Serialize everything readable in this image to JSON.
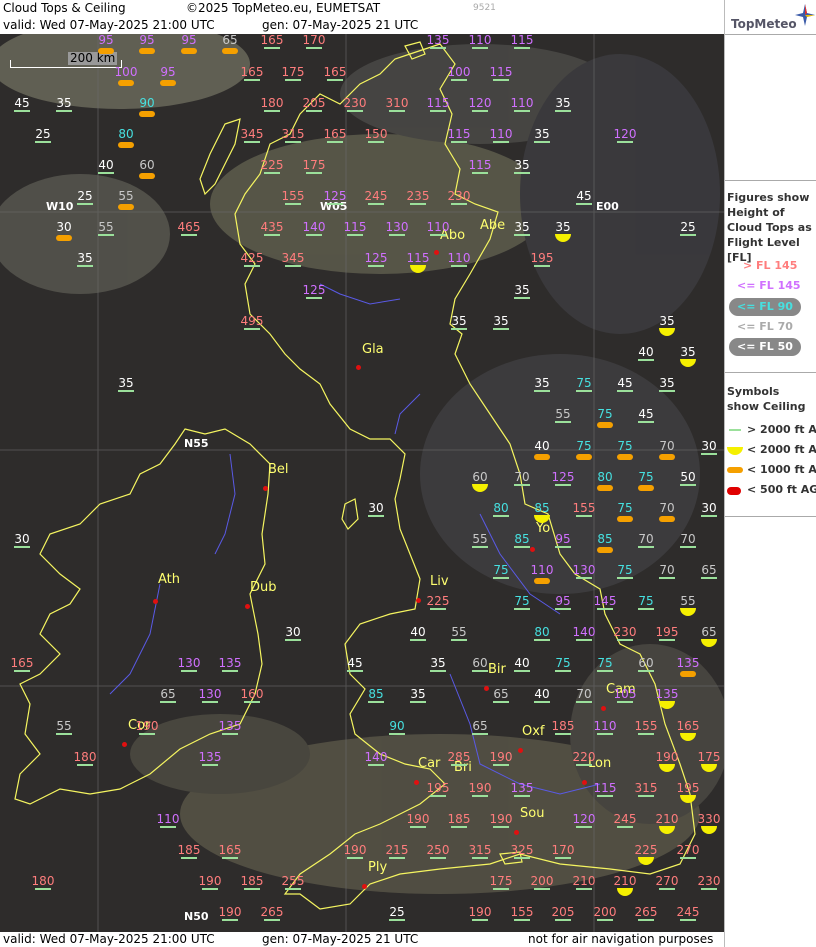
{
  "header": {
    "title": "Cloud Tops & Ceiling",
    "copyright": "©2025 TopMeteo.eu, EUMETSAT",
    "id_code": "9521",
    "valid_text": "valid:  Wed  07-May-2025  21:00 UTC",
    "gen_text": "gen: 07-May-2025 21 UTC"
  },
  "footer": {
    "valid_text": "valid:  Wed  07-May-2025  21:00 UTC",
    "gen_text": "gen: 07-May-2025 21 UTC",
    "disclaimer": "not for air navigation purposes"
  },
  "logo": {
    "text": "TopMeteo"
  },
  "scale_bar": {
    "label": "200 km"
  },
  "grid_labels": [
    "W10",
    "W05",
    "E00",
    "N55",
    "N50"
  ],
  "cities": [
    "Abo",
    "Abe",
    "Gla",
    "Bel",
    "Ath",
    "Dub",
    "Liv",
    "Yo",
    "Bir",
    "Cam",
    "Cor",
    "Oxf",
    "Car",
    "Bri",
    "Lon",
    "Sou",
    "Ply"
  ],
  "colors": {
    "above_145": "#ff7d7d",
    "le_145": "#d070ff",
    "le_90": "#46e0e0",
    "le_70": "#c8c8c8",
    "le_50": "#ffffff",
    "coast": "#f5f560",
    "river": "#5a5ae6",
    "sea": "#2e2c2b",
    "ceiling_2000": "#f5f000",
    "ceiling_1000": "#f5a000",
    "ceiling_500": "#e00000"
  },
  "legend": {
    "figures_title": "Figures show Height of Cloud Tops as Flight Level  [FL]",
    "fl_items": [
      "> FL 145",
      "<= FL 145",
      "<= FL 90",
      "<= FL 70",
      "<= FL 50"
    ],
    "symbols_title": "Symbols show Ceiling",
    "symbol_items": [
      "> 2000 ft AGL",
      "< 2000 ft AGL",
      "< 1000 ft AGL",
      "< 500 ft AGL"
    ]
  },
  "cloud_tops": [
    {
      "v": "95",
      "s": "p"
    },
    {
      "v": "95",
      "s": "p"
    },
    {
      "v": "95",
      "s": "p"
    },
    {
      "v": "65",
      "s": "p"
    },
    {
      "v": "165"
    },
    {
      "v": "170"
    },
    {
      "v": "135"
    },
    {
      "v": "110"
    },
    {
      "v": "115"
    },
    {
      "v": "100",
      "s": "p"
    },
    {
      "v": "95",
      "s": "p"
    },
    {
      "v": "165"
    },
    {
      "v": "175"
    },
    {
      "v": "165"
    },
    {
      "v": "100"
    },
    {
      "v": "115"
    },
    {
      "v": "45"
    },
    {
      "v": "35"
    },
    {
      "v": "90",
      "s": "p"
    },
    {
      "v": "180"
    },
    {
      "v": "205"
    },
    {
      "v": "230"
    },
    {
      "v": "310"
    },
    {
      "v": "115"
    },
    {
      "v": "120"
    },
    {
      "v": "110"
    },
    {
      "v": "35"
    },
    {
      "v": "25"
    },
    {
      "v": "80",
      "s": "p"
    },
    {
      "v": "345"
    },
    {
      "v": "315"
    },
    {
      "v": "165"
    },
    {
      "v": "150"
    },
    {
      "v": "115"
    },
    {
      "v": "110"
    },
    {
      "v": "35"
    },
    {
      "v": "120"
    },
    {
      "v": "40"
    },
    {
      "v": "60",
      "s": "p"
    },
    {
      "v": "225"
    },
    {
      "v": "175"
    },
    {
      "v": "115"
    },
    {
      "v": "35"
    },
    {
      "v": "25"
    },
    {
      "v": "55",
      "s": "p"
    },
    {
      "v": "155"
    },
    {
      "v": "125"
    },
    {
      "v": "245"
    },
    {
      "v": "235"
    },
    {
      "v": "230"
    },
    {
      "v": "45"
    },
    {
      "v": "30",
      "s": "p"
    },
    {
      "v": "55"
    },
    {
      "v": "465"
    },
    {
      "v": "435"
    },
    {
      "v": "140"
    },
    {
      "v": "115"
    },
    {
      "v": "130"
    },
    {
      "v": "110"
    },
    {
      "v": "35"
    },
    {
      "v": "35",
      "s": "c"
    },
    {
      "v": "25"
    },
    {
      "v": "35"
    },
    {
      "v": "425"
    },
    {
      "v": "345"
    },
    {
      "v": "125"
    },
    {
      "v": "115",
      "s": "c"
    },
    {
      "v": "110"
    },
    {
      "v": "195"
    },
    {
      "v": "125"
    },
    {
      "v": "35"
    },
    {
      "v": "495"
    },
    {
      "v": "35"
    },
    {
      "v": "35"
    },
    {
      "v": "35",
      "s": "c"
    },
    {
      "v": "40"
    },
    {
      "v": "35",
      "s": "c"
    },
    {
      "v": "35"
    },
    {
      "v": "35"
    },
    {
      "v": "75"
    },
    {
      "v": "45"
    },
    {
      "v": "35"
    },
    {
      "v": "55"
    },
    {
      "v": "75",
      "s": "p"
    },
    {
      "v": "45"
    },
    {
      "v": "40",
      "s": "p"
    },
    {
      "v": "75",
      "s": "p"
    },
    {
      "v": "75",
      "s": "p"
    },
    {
      "v": "70",
      "s": "p"
    },
    {
      "v": "30"
    },
    {
      "v": "60",
      "s": "c"
    },
    {
      "v": "70"
    },
    {
      "v": "125"
    },
    {
      "v": "80",
      "s": "p"
    },
    {
      "v": "75",
      "s": "p"
    },
    {
      "v": "50"
    },
    {
      "v": "30"
    },
    {
      "v": "80"
    },
    {
      "v": "85",
      "s": "c"
    },
    {
      "v": "155"
    },
    {
      "v": "75",
      "s": "p"
    },
    {
      "v": "70",
      "s": "p"
    },
    {
      "v": "30"
    },
    {
      "v": "30"
    },
    {
      "v": "55"
    },
    {
      "v": "85"
    },
    {
      "v": "95"
    },
    {
      "v": "85",
      "s": "p"
    },
    {
      "v": "70"
    },
    {
      "v": "70"
    },
    {
      "v": "75"
    },
    {
      "v": "110",
      "s": "p"
    },
    {
      "v": "130"
    },
    {
      "v": "75"
    },
    {
      "v": "70"
    },
    {
      "v": "65"
    },
    {
      "v": "75"
    },
    {
      "v": "95"
    },
    {
      "v": "145"
    },
    {
      "v": "75"
    },
    {
      "v": "55",
      "s": "c"
    },
    {
      "v": "225"
    },
    {
      "v": "30"
    },
    {
      "v": "40"
    },
    {
      "v": "55"
    },
    {
      "v": "80"
    },
    {
      "v": "140"
    },
    {
      "v": "230"
    },
    {
      "v": "195"
    },
    {
      "v": "65",
      "s": "c"
    },
    {
      "v": "165"
    },
    {
      "v": "130"
    },
    {
      "v": "135"
    },
    {
      "v": "45"
    },
    {
      "v": "35"
    },
    {
      "v": "60"
    },
    {
      "v": "40"
    },
    {
      "v": "75"
    },
    {
      "v": "75"
    },
    {
      "v": "60"
    },
    {
      "v": "135",
      "s": "p"
    },
    {
      "v": "65"
    },
    {
      "v": "130"
    },
    {
      "v": "160"
    },
    {
      "v": "85"
    },
    {
      "v": "35"
    },
    {
      "v": "65"
    },
    {
      "v": "40"
    },
    {
      "v": "70"
    },
    {
      "v": "105"
    },
    {
      "v": "135",
      "s": "c"
    },
    {
      "v": "55"
    },
    {
      "v": "190"
    },
    {
      "v": "135"
    },
    {
      "v": "90"
    },
    {
      "v": "65"
    },
    {
      "v": "185"
    },
    {
      "v": "110"
    },
    {
      "v": "155"
    },
    {
      "v": "165",
      "s": "c"
    },
    {
      "v": "180"
    },
    {
      "v": "135"
    },
    {
      "v": "140"
    },
    {
      "v": "285"
    },
    {
      "v": "190"
    },
    {
      "v": "220"
    },
    {
      "v": "190",
      "s": "c"
    },
    {
      "v": "175",
      "s": "c"
    },
    {
      "v": "195"
    },
    {
      "v": "190"
    },
    {
      "v": "135"
    },
    {
      "v": "115"
    },
    {
      "v": "315"
    },
    {
      "v": "195",
      "s": "c"
    },
    {
      "v": "110"
    },
    {
      "v": "190"
    },
    {
      "v": "185"
    },
    {
      "v": "190"
    },
    {
      "v": "120"
    },
    {
      "v": "245"
    },
    {
      "v": "210",
      "s": "c"
    },
    {
      "v": "330",
      "s": "c"
    },
    {
      "v": "185"
    },
    {
      "v": "165"
    },
    {
      "v": "190"
    },
    {
      "v": "215"
    },
    {
      "v": "250"
    },
    {
      "v": "315"
    },
    {
      "v": "325"
    },
    {
      "v": "170"
    },
    {
      "v": "225",
      "s": "c"
    },
    {
      "v": "270"
    },
    {
      "v": "180"
    },
    {
      "v": "190"
    },
    {
      "v": "185"
    },
    {
      "v": "255"
    },
    {
      "v": "175"
    },
    {
      "v": "200"
    },
    {
      "v": "210"
    },
    {
      "v": "210",
      "s": "c"
    },
    {
      "v": "270"
    },
    {
      "v": "230"
    },
    {
      "v": "190"
    },
    {
      "v": "265"
    },
    {
      "v": "25"
    },
    {
      "v": "190"
    },
    {
      "v": "155"
    },
    {
      "v": "205"
    },
    {
      "v": "200"
    },
    {
      "v": "265"
    },
    {
      "v": "245"
    }
  ]
}
